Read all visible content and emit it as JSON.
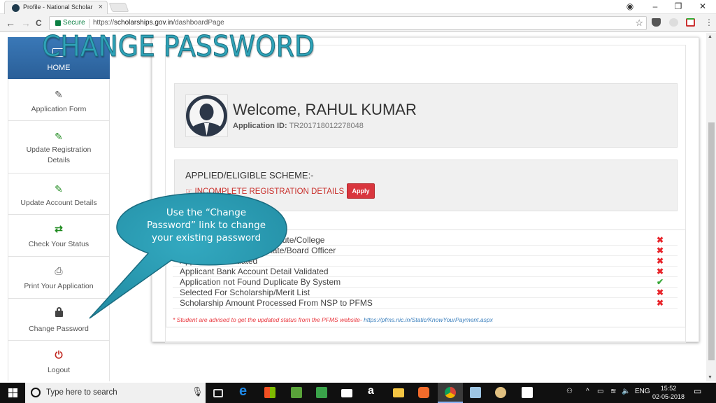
{
  "browser": {
    "tab_title": "Profile - National Scholar",
    "tab_close": "×",
    "secure_label": "Secure",
    "url_scheme": "https://",
    "url_host": "scholarships.gov.in",
    "url_path": "/dashboardPage",
    "back": "←",
    "forward": "→",
    "reload": "C",
    "star": "☆",
    "window_controls": {
      "profile": "◉",
      "minimize": "–",
      "restore": "❐",
      "close": "✕"
    },
    "menu": "⋮"
  },
  "overlay": {
    "title": "CHANGE PASSWORD",
    "callout": "Use the “Change Password” link to change your existing password",
    "callout_color": "#2a9db5"
  },
  "sidebar": {
    "home": {
      "label": "HOME",
      "icon": "envelope-icon"
    },
    "items": [
      {
        "label": "Application Form",
        "icon": "edit-icon",
        "glyph": "✎",
        "color": "#555555"
      },
      {
        "label": "Update Registration Details",
        "icon": "edit-icon",
        "glyph": "✎",
        "color": "#1e8a1e"
      },
      {
        "label": "Update Account Details",
        "icon": "edit-icon",
        "glyph": "✎",
        "color": "#1e8a1e"
      },
      {
        "label": "Check Your Status",
        "icon": "exchange-icon",
        "glyph": "⇄",
        "color": "#1e8a1e"
      },
      {
        "label": "Print Your Application",
        "icon": "print-icon",
        "glyph": "⎙",
        "color": "#555555"
      },
      {
        "label": "Change Password",
        "icon": "lock-icon",
        "glyph": "🔒",
        "color": "#444444"
      },
      {
        "label": "Logout",
        "icon": "power-icon",
        "glyph": "⏻",
        "color": "#c0271f"
      }
    ]
  },
  "welcome": {
    "greeting": "Welcome, RAHUL KUMAR",
    "app_id_label": "Application ID:",
    "app_id": "TR201718012278048"
  },
  "scheme": {
    "heading": "APPLIED/ELIGIBLE SCHEME:-",
    "status": "☞ INCOMPLETE REGISTRATION DETAILS -",
    "apply_label": "Apply"
  },
  "status_rows": [
    {
      "text": "Application Verified by Institute/College",
      "ok": false,
      "mark": "✖"
    },
    {
      "text": "Application Verified by State/Board Officer",
      "ok": false,
      "mark": "✖"
    },
    {
      "text": "Application Validated",
      "ok": false,
      "mark": "✖"
    },
    {
      "text": "Applicant Bank Account Detail Validated",
      "ok": false,
      "mark": "✖"
    },
    {
      "text": "Application not Found Duplicate By System",
      "ok": true,
      "mark": "✔"
    },
    {
      "text": "Selected For Scholarship/Merit List",
      "ok": false,
      "mark": "✖"
    },
    {
      "text": "Scholarship Amount Processed From NSP to PFMS",
      "ok": false,
      "mark": "✖"
    }
  ],
  "status_note": {
    "text": "* Student are advised to get the updated status from the PFMS website-",
    "link": "https://pfms.nic.in/Static/KnowYourPayment.aspx"
  },
  "colors": {
    "fail": "#e8242a",
    "ok": "#3aa83a",
    "home_bg": "#2f6aa8"
  },
  "taskbar": {
    "search_placeholder": "Type here to search",
    "tray": {
      "people": "⚇",
      "chevron": "^",
      "lang": "ENG"
    },
    "time": "15:52",
    "date": "02-05-2018",
    "apps": [
      "task-view",
      "edge",
      "store",
      "cloud-app",
      "evernote",
      "mail",
      "amazon",
      "file-explorer",
      "wps",
      "chrome",
      "notepad",
      "paint",
      "photos"
    ]
  }
}
